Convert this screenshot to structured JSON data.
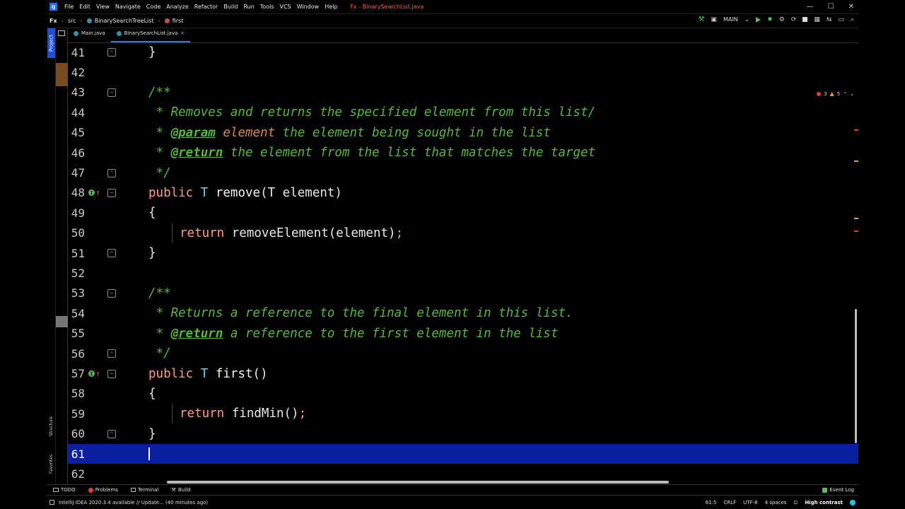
{
  "menu": {
    "logo": "IJ",
    "items": [
      "File",
      "Edit",
      "View",
      "Navigate",
      "Code",
      "Analyze",
      "Refactor",
      "Build",
      "Run",
      "Tools",
      "VCS",
      "Window",
      "Help"
    ],
    "title": "Fx - BinarySearchList.java",
    "controls": [
      "—",
      "☐",
      "✕"
    ]
  },
  "nav": {
    "crumbs": [
      "Fx",
      "src",
      "BinarySearchTreeList",
      "first"
    ],
    "run_config": "MAIN"
  },
  "left_strip": {
    "project": "Project",
    "structure": "Structure",
    "favorites": "Favorites"
  },
  "tabs": [
    {
      "label": "Main.java"
    },
    {
      "label": "BinarySearchList.java",
      "close": "×"
    }
  ],
  "inspection": {
    "errors": "3",
    "warnings": "5"
  },
  "lines": [
    {
      "num": "41"
    },
    {
      "num": "42"
    },
    {
      "num": "43",
      "c": "/**"
    },
    {
      "num": "44",
      "c": " * Removes and returns the specified element from this list/"
    },
    {
      "num": "45",
      "p1": " * ",
      "tag": "@param",
      "p2": " ",
      "param": "element",
      "p3": " the element being sought in the list"
    },
    {
      "num": "46",
      "p1": " * ",
      "tag": "@return",
      "p3": " the element from the list that matches the target"
    },
    {
      "num": "47",
      "c": " */"
    },
    {
      "num": "48",
      "kw": "public",
      "tp": "T",
      "fn": "remove",
      "rest": "(T element)"
    },
    {
      "num": "49",
      "brace": "{"
    },
    {
      "num": "50",
      "kw": "return",
      "call": "removeElement(element)",
      "semi": ";"
    },
    {
      "num": "51",
      "brace": "}"
    },
    {
      "num": "52"
    },
    {
      "num": "53",
      "c": "/**"
    },
    {
      "num": "54",
      "c": " * Returns a reference to the final element in this list."
    },
    {
      "num": "55",
      "p1": " * ",
      "tag": "@return",
      "p3": " a reference to the first element in the list"
    },
    {
      "num": "56",
      "c": " */"
    },
    {
      "num": "57",
      "kw": "public",
      "tp": "T",
      "fn": "first",
      "rest": "()"
    },
    {
      "num": "58",
      "brace": "{"
    },
    {
      "num": "59",
      "kw": "return",
      "call": "findMin()",
      "semi": ";"
    },
    {
      "num": "60",
      "brace": "}"
    },
    {
      "num": "61"
    },
    {
      "num": "62"
    }
  ],
  "bottom_tools": [
    "TODO",
    "Problems",
    "Terminal",
    "Build"
  ],
  "event_log": "Event Log",
  "status": {
    "message": "IntelliJ IDEA 2020.3.4 available // Update... (40 minutes ago)",
    "position": "61:5",
    "line_sep": "CRLF",
    "encoding": "UTF-8",
    "indent": "4 spaces",
    "scheme": "High contrast"
  }
}
